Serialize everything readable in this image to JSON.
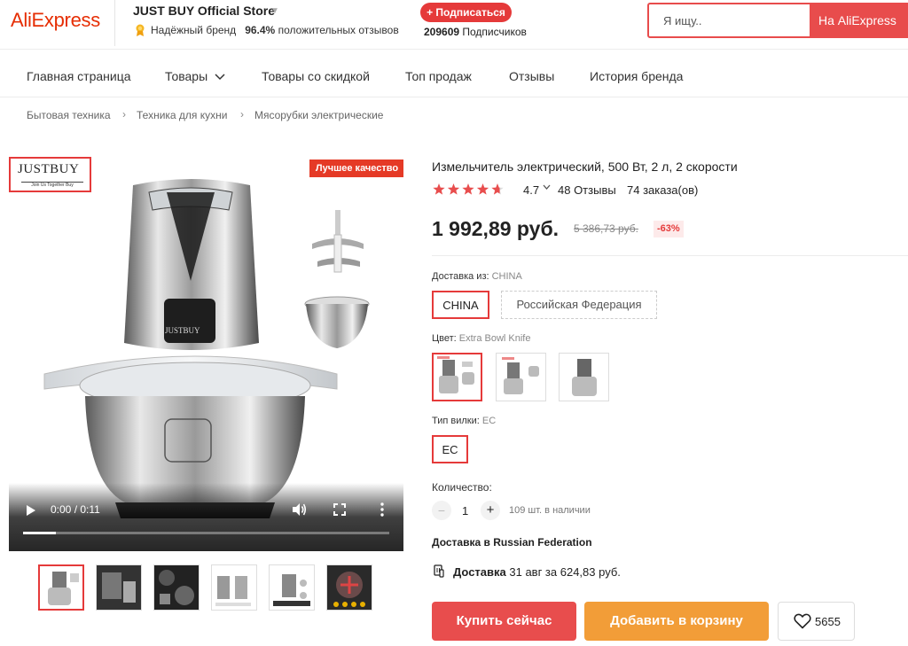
{
  "header": {
    "logo": "AliExpress",
    "store_name": "JUST BUY Official Store",
    "trusted_brand": "Надёжный бренд",
    "positive_pct": "96.4%",
    "positive_label": "положительных отзывов",
    "subscribe_label": "+ Подписаться",
    "subscribers_count": "209609",
    "subscribers_label": "Подписчиков",
    "search_placeholder": "Я ищу..",
    "search_button": "На AliExpress"
  },
  "nav": {
    "items": [
      "Главная страница",
      "Товары",
      "Товары со скидкой",
      "Топ продаж",
      "Отзывы",
      "История бренда"
    ]
  },
  "breadcrumb": [
    "Бытовая техника",
    "Техника для кухни",
    "Мясорубки электрические"
  ],
  "gallery": {
    "brand_logo": "JUSTBUY",
    "brand_tagline": "Join Us Together Buy",
    "badge": "Лучшее качество",
    "video_time": "0:00 / 0:11",
    "video_progress": 0.09,
    "thumbnail_count": 6
  },
  "product": {
    "title": "Измельчитель электрический, 500 Вт, 2 л, 2 скорости",
    "rating": "4.7",
    "rating_value": 4.7,
    "reviews": "48 Отзывы",
    "orders": "74 заказа(ов)",
    "price": "1 992,89 руб.",
    "old_price": "5 386,73 руб.",
    "discount": "-63%"
  },
  "options": {
    "ship_from_label": "Доставка из:",
    "ship_from_value": "CHINA",
    "ship_from_options": [
      "CHINA",
      "Российская Федерация"
    ],
    "color_label": "Цвет:",
    "color_value": "Extra Bowl Knife",
    "plug_label": "Тип вилки:",
    "plug_value": "EC",
    "plug_options": [
      "EC"
    ]
  },
  "quantity": {
    "label": "Количество:",
    "minus": "−",
    "value": "1",
    "plus": "+",
    "stock": "109 шт. в наличии"
  },
  "shipping": {
    "heading": "Доставка в Russian Federation",
    "label": "Доставка",
    "details": "31 авг за 624,83 руб."
  },
  "actions": {
    "buy_now": "Купить сейчас",
    "add_to_cart": "Добавить в корзину",
    "wishlist_count": "5655"
  },
  "colors": {
    "accent": "#e84d4d",
    "cart": "#f29d38",
    "brand": "#e62e04"
  }
}
